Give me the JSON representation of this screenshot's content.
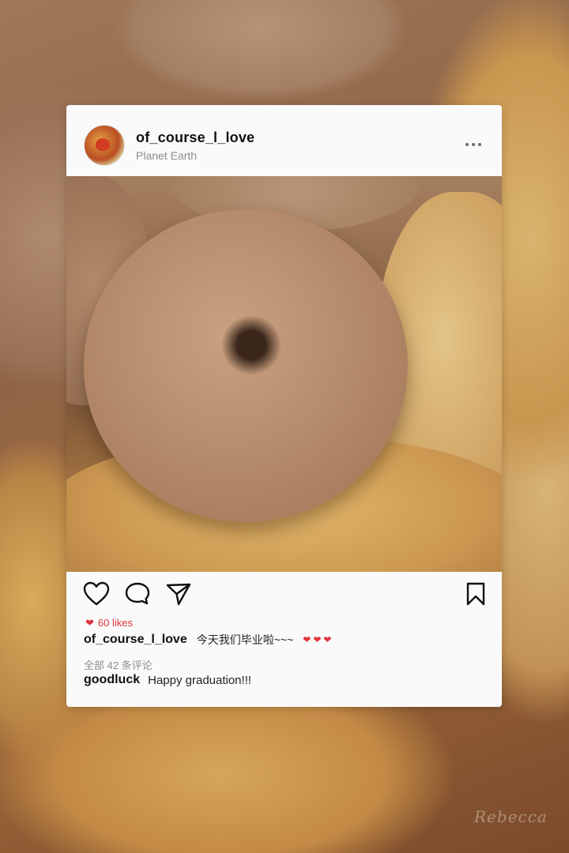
{
  "post": {
    "username": "of_course_l_love",
    "location": "Planet Earth",
    "more_icon": "more-dots-icon",
    "likes": "60 likes",
    "caption": {
      "user": "of_course_l_love",
      "text": "今天我们毕业啦~~~",
      "hearts": "❤❤❤"
    },
    "view_comments": "全部 42 条评论",
    "comment": {
      "user": "goodluck",
      "text": "Happy graduation!!!"
    }
  },
  "watermark": "Rebecca",
  "colors": {
    "like_red": "#e0323a",
    "card_bg": "#fafafa",
    "muted_text": "#8e8e8e"
  },
  "icons": [
    "heart-icon",
    "comment-icon",
    "send-icon",
    "bookmark-icon"
  ]
}
